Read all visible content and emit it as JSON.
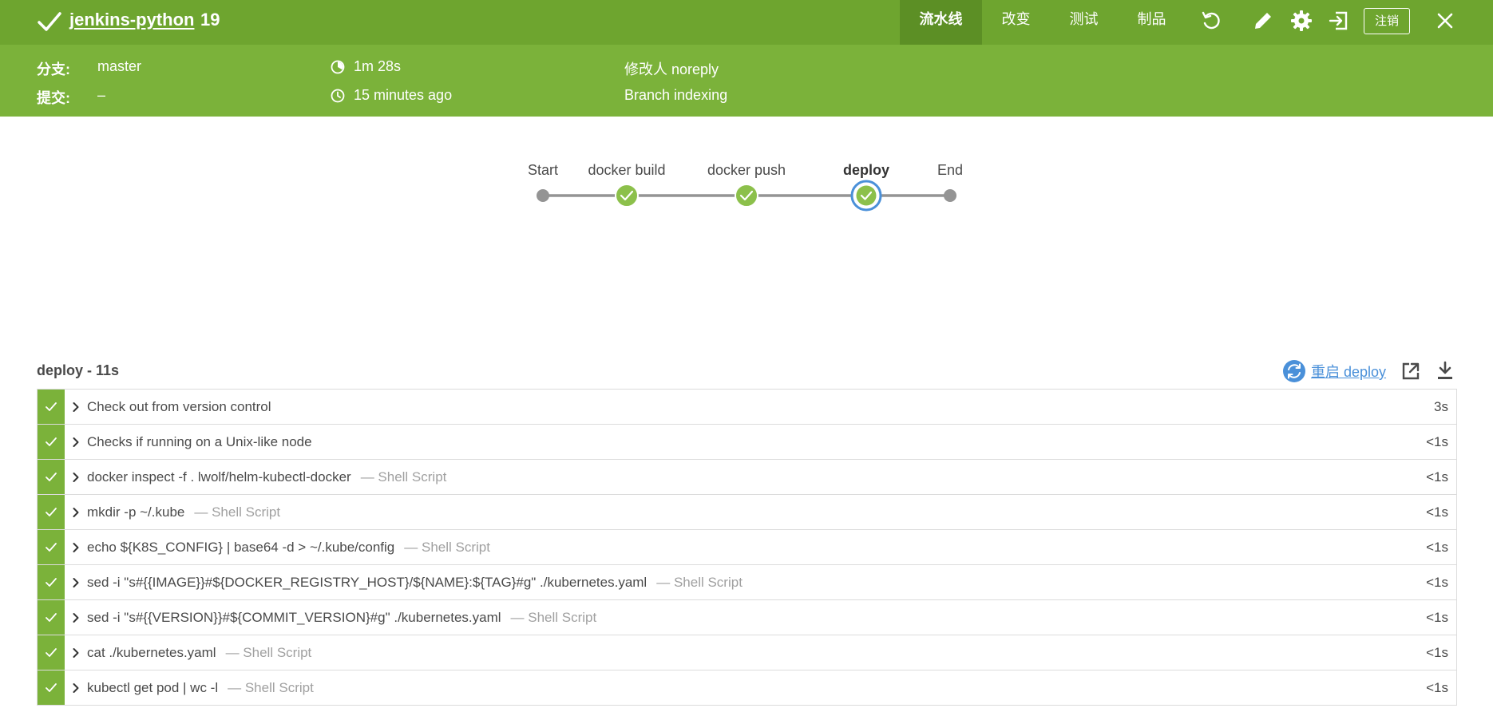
{
  "header": {
    "job_name": "jenkins-python",
    "run_number": "19",
    "tabs": [
      {
        "label": "流水线",
        "active": true
      },
      {
        "label": "改变",
        "active": false
      },
      {
        "label": "测试",
        "active": false
      },
      {
        "label": "制品",
        "active": false
      }
    ],
    "icons": [
      "replay-icon",
      "edit-icon",
      "gear-icon",
      "exit-icon",
      "close-icon"
    ],
    "logout_label": "注销"
  },
  "run_info": {
    "branch_label": "分支:",
    "branch_value": "master",
    "commit_label": "提交:",
    "commit_value": "–",
    "duration": "1m 28s",
    "time_ago": "15 minutes ago",
    "changes_by": "修改人 noreply",
    "cause": "Branch indexing"
  },
  "pipeline": {
    "stages": [
      {
        "label": "Start",
        "type": "start"
      },
      {
        "label": "docker build",
        "type": "success"
      },
      {
        "label": "docker push",
        "type": "success"
      },
      {
        "label": "deploy",
        "type": "success",
        "selected": true
      },
      {
        "label": "End",
        "type": "end"
      }
    ]
  },
  "stage_detail": {
    "title": "deploy - 11s",
    "restart_label": "重启 deploy",
    "steps": [
      {
        "title": "Check out from version control",
        "type": "",
        "duration": "3s"
      },
      {
        "title": "Checks if running on a Unix-like node",
        "type": "",
        "duration": "<1s"
      },
      {
        "title": "docker inspect -f . lwolf/helm-kubectl-docker",
        "type": "— Shell Script",
        "duration": "<1s"
      },
      {
        "title": "mkdir -p ~/.kube",
        "type": "— Shell Script",
        "duration": "<1s"
      },
      {
        "title": "echo ${K8S_CONFIG} | base64 -d > ~/.kube/config",
        "type": "— Shell Script",
        "duration": "<1s"
      },
      {
        "title": "sed -i \"s#{{IMAGE}}#${DOCKER_REGISTRY_HOST}/${NAME}:${TAG}#g\" ./kubernetes.yaml",
        "type": "— Shell Script",
        "duration": "<1s"
      },
      {
        "title": "sed -i \"s#{{VERSION}}#${COMMIT_VERSION}#g\" ./kubernetes.yaml",
        "type": "— Shell Script",
        "duration": "<1s"
      },
      {
        "title": "cat ./kubernetes.yaml",
        "type": "— Shell Script",
        "duration": "<1s"
      },
      {
        "title": "kubectl get pod | wc -l",
        "type": "— Shell Script",
        "duration": "<1s"
      }
    ]
  },
  "colors": {
    "header_bg": "#6ea52f",
    "info_bg": "#7bb23a",
    "success": "#8cc04b",
    "selected_ring": "#4a90d9",
    "node_gray": "#949494",
    "link": "#4a90d9"
  }
}
